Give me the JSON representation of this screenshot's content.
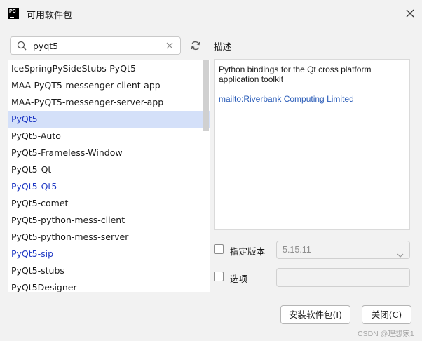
{
  "window": {
    "title": "可用软件包",
    "logo_text": "PC"
  },
  "search": {
    "value": "pyqt5"
  },
  "packages": [
    {
      "name": "IceSpringPySideStubs-PyQt5",
      "selected": false,
      "link": false
    },
    {
      "name": "MAA-PyQT5-messenger-client-app",
      "selected": false,
      "link": false
    },
    {
      "name": "MAA-PyQT5-messenger-server-app",
      "selected": false,
      "link": false
    },
    {
      "name": "PyQt5",
      "selected": true,
      "link": true
    },
    {
      "name": "PyQt5-Auto",
      "selected": false,
      "link": false
    },
    {
      "name": "PyQt5-Frameless-Window",
      "selected": false,
      "link": false
    },
    {
      "name": "PyQt5-Qt",
      "selected": false,
      "link": false
    },
    {
      "name": "PyQt5-Qt5",
      "selected": false,
      "link": true
    },
    {
      "name": "PyQt5-comet",
      "selected": false,
      "link": false
    },
    {
      "name": "PyQt5-python-mess-client",
      "selected": false,
      "link": false
    },
    {
      "name": "PyQt5-python-mess-server",
      "selected": false,
      "link": false
    },
    {
      "name": "PyQt5-sip",
      "selected": false,
      "link": true
    },
    {
      "name": "PyQt5-stubs",
      "selected": false,
      "link": false
    },
    {
      "name": "PyQt5Designer",
      "selected": false,
      "link": false
    }
  ],
  "description": {
    "label": "描述",
    "text": "Python bindings for the Qt cross platform application toolkit",
    "link": "mailto:Riverbank Computing Limited"
  },
  "options": {
    "specify_version_label": "指定版本",
    "version_value": "5.15.11",
    "options_label": "选项",
    "specify_version_checked": false,
    "options_checked": false
  },
  "buttons": {
    "install": "安装软件包(I)",
    "close": "关闭(C)"
  },
  "watermark": "CSDN @理想家1",
  "colors": {
    "selection": "#d4e0f9",
    "link": "#1f38c4",
    "desc_link": "#2a5cb8"
  }
}
